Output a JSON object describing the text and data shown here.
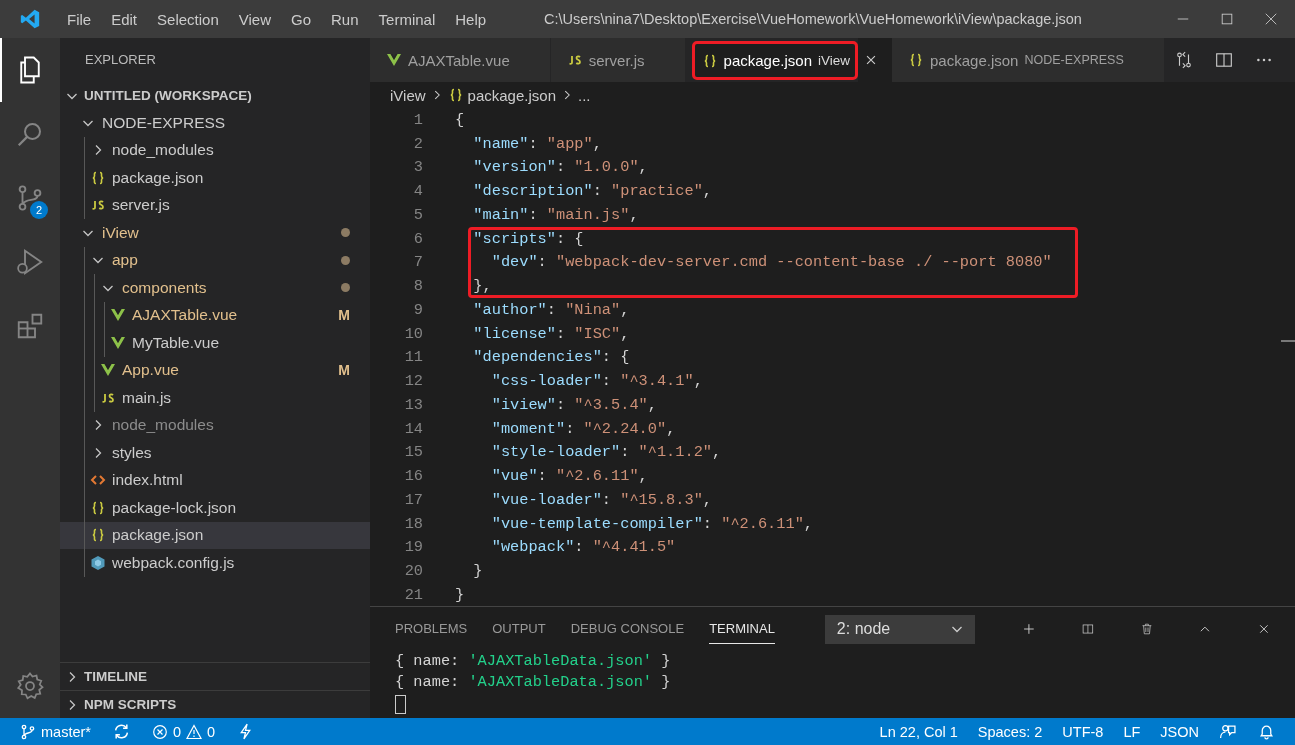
{
  "title_bar": {
    "menus": [
      "File",
      "Edit",
      "Selection",
      "View",
      "Go",
      "Run",
      "Terminal",
      "Help"
    ],
    "title": "C:\\Users\\nina7\\Desktop\\Exercise\\VueHomework\\VueHomework\\iView\\package.json"
  },
  "activity_bar": {
    "source_control_badge": "2"
  },
  "sidebar": {
    "title": "EXPLORER",
    "workspace": {
      "label": "UNTITLED (WORKSPACE)",
      "expanded": true
    },
    "tree": [
      {
        "kind": "folder",
        "label": "NODE-EXPRESS",
        "expanded": true,
        "selected": false,
        "children": [
          {
            "kind": "folder",
            "label": "node_modules",
            "expanded": false,
            "selected": false
          },
          {
            "kind": "json",
            "label": "package.json",
            "selected": false
          },
          {
            "kind": "js",
            "label": "server.js",
            "selected": false
          }
        ]
      },
      {
        "kind": "folder",
        "label": "iView",
        "expanded": true,
        "changed": true,
        "selected": false,
        "children": [
          {
            "kind": "folder",
            "label": "app",
            "expanded": true,
            "changed": true,
            "selected": false,
            "children": [
              {
                "kind": "folder",
                "label": "components",
                "expanded": true,
                "changed": true,
                "selected": false,
                "children": [
                  {
                    "kind": "vue",
                    "label": "AJAXTable.vue",
                    "badge": "M",
                    "selected": false
                  },
                  {
                    "kind": "vue",
                    "label": "MyTable.vue",
                    "selected": false
                  }
                ]
              },
              {
                "kind": "vue",
                "label": "App.vue",
                "badge": "M",
                "selected": false
              },
              {
                "kind": "js",
                "label": "main.js",
                "selected": false
              }
            ]
          },
          {
            "kind": "folder",
            "label": "node_modules",
            "expanded": false,
            "ignored": true,
            "selected": false
          },
          {
            "kind": "folder",
            "label": "styles",
            "expanded": false,
            "selected": false
          },
          {
            "kind": "html",
            "label": "index.html",
            "selected": false
          },
          {
            "kind": "json",
            "label": "package-lock.json",
            "selected": false
          },
          {
            "kind": "json",
            "label": "package.json",
            "selected": true
          },
          {
            "kind": "webpack",
            "label": "webpack.config.js",
            "selected": false
          }
        ]
      }
    ],
    "sections": [
      {
        "label": "TIMELINE",
        "expanded": false
      },
      {
        "label": "NPM SCRIPTS",
        "expanded": false
      }
    ]
  },
  "editor": {
    "tabs": [
      {
        "kind": "vue",
        "label": "AJAXTable.vue",
        "selected": false,
        "highlighted": false
      },
      {
        "kind": "js",
        "label": "server.js",
        "selected": false,
        "highlighted": false
      },
      {
        "kind": "json",
        "label": "package.json",
        "description": "iView",
        "selected": true,
        "highlighted": true
      },
      {
        "kind": "json",
        "label": "package.json",
        "description": "NODE-EXPRESS",
        "selected": false,
        "highlighted": false
      }
    ],
    "breadcrumb": [
      {
        "label": "iView"
      },
      {
        "label": "package.json",
        "kind": "json"
      },
      {
        "label": "..."
      }
    ],
    "lines": [
      {
        "number": "1",
        "highlighted": false,
        "tokens": [
          {
            "kind": "p",
            "text": "{"
          }
        ]
      },
      {
        "number": "2",
        "highlighted": false,
        "tokens": [
          {
            "kind": "k",
            "text": "\"name\""
          },
          {
            "kind": "p",
            "text": ": "
          },
          {
            "kind": "s",
            "text": "\"app\""
          },
          {
            "kind": "p",
            "text": ","
          }
        ]
      },
      {
        "number": "3",
        "highlighted": false,
        "tokens": [
          {
            "kind": "k",
            "text": "\"version\""
          },
          {
            "kind": "p",
            "text": ": "
          },
          {
            "kind": "s",
            "text": "\"1.0.0\""
          },
          {
            "kind": "p",
            "text": ","
          }
        ]
      },
      {
        "number": "4",
        "highlighted": false,
        "tokens": [
          {
            "kind": "k",
            "text": "\"description\""
          },
          {
            "kind": "p",
            "text": ": "
          },
          {
            "kind": "s",
            "text": "\"practice\""
          },
          {
            "kind": "p",
            "text": ","
          }
        ]
      },
      {
        "number": "5",
        "highlighted": false,
        "tokens": [
          {
            "kind": "k",
            "text": "\"main\""
          },
          {
            "kind": "p",
            "text": ": "
          },
          {
            "kind": "s",
            "text": "\"main.js\""
          },
          {
            "kind": "p",
            "text": ","
          }
        ]
      },
      {
        "number": "6",
        "highlighted": true,
        "tokens": [
          {
            "kind": "k",
            "text": "\"scripts\""
          },
          {
            "kind": "p",
            "text": ": {"
          }
        ]
      },
      {
        "number": "7",
        "highlighted": true,
        "tokens": [
          {
            "kind": "k",
            "text": "\"dev\""
          },
          {
            "kind": "p",
            "text": ": "
          },
          {
            "kind": "s",
            "text": "\"webpack-dev-server.cmd --content-base ./ --port 8080\""
          }
        ]
      },
      {
        "number": "8",
        "highlighted": true,
        "tokens": [
          {
            "kind": "p",
            "text": "},"
          }
        ]
      },
      {
        "number": "9",
        "highlighted": false,
        "tokens": [
          {
            "kind": "k",
            "text": "\"author\""
          },
          {
            "kind": "p",
            "text": ": "
          },
          {
            "kind": "s",
            "text": "\"Nina\""
          },
          {
            "kind": "p",
            "text": ","
          }
        ]
      },
      {
        "number": "10",
        "highlighted": false,
        "tokens": [
          {
            "kind": "k",
            "text": "\"license\""
          },
          {
            "kind": "p",
            "text": ": "
          },
          {
            "kind": "s",
            "text": "\"ISC\""
          },
          {
            "kind": "p",
            "text": ","
          }
        ]
      },
      {
        "number": "11",
        "highlighted": false,
        "tokens": [
          {
            "kind": "k",
            "text": "\"dependencies\""
          },
          {
            "kind": "p",
            "text": ": {"
          }
        ]
      },
      {
        "number": "12",
        "highlighted": false,
        "tokens": [
          {
            "kind": "k",
            "text": "\"css-loader\""
          },
          {
            "kind": "p",
            "text": ": "
          },
          {
            "kind": "s",
            "text": "\"^3.4.1\""
          },
          {
            "kind": "p",
            "text": ","
          }
        ]
      },
      {
        "number": "13",
        "highlighted": false,
        "tokens": [
          {
            "kind": "k",
            "text": "\"iview\""
          },
          {
            "kind": "p",
            "text": ": "
          },
          {
            "kind": "s",
            "text": "\"^3.5.4\""
          },
          {
            "kind": "p",
            "text": ","
          }
        ]
      },
      {
        "number": "14",
        "highlighted": false,
        "tokens": [
          {
            "kind": "k",
            "text": "\"moment\""
          },
          {
            "kind": "p",
            "text": ": "
          },
          {
            "kind": "s",
            "text": "\"^2.24.0\""
          },
          {
            "kind": "p",
            "text": ","
          }
        ]
      },
      {
        "number": "15",
        "highlighted": false,
        "tokens": [
          {
            "kind": "k",
            "text": "\"style-loader\""
          },
          {
            "kind": "p",
            "text": ": "
          },
          {
            "kind": "s",
            "text": "\"^1.1.2\""
          },
          {
            "kind": "p",
            "text": ","
          }
        ]
      },
      {
        "number": "16",
        "highlighted": false,
        "tokens": [
          {
            "kind": "k",
            "text": "\"vue\""
          },
          {
            "kind": "p",
            "text": ": "
          },
          {
            "kind": "s",
            "text": "\"^2.6.11\""
          },
          {
            "kind": "p",
            "text": ","
          }
        ]
      },
      {
        "number": "17",
        "highlighted": false,
        "tokens": [
          {
            "kind": "k",
            "text": "\"vue-loader\""
          },
          {
            "kind": "p",
            "text": ": "
          },
          {
            "kind": "s",
            "text": "\"^15.8.3\""
          },
          {
            "kind": "p",
            "text": ","
          }
        ]
      },
      {
        "number": "18",
        "highlighted": false,
        "tokens": [
          {
            "kind": "k",
            "text": "\"vue-template-compiler\""
          },
          {
            "kind": "p",
            "text": ": "
          },
          {
            "kind": "s",
            "text": "\"^2.6.11\""
          },
          {
            "kind": "p",
            "text": ","
          }
        ]
      },
      {
        "number": "19",
        "highlighted": false,
        "tokens": [
          {
            "kind": "k",
            "text": "\"webpack\""
          },
          {
            "kind": "p",
            "text": ": "
          },
          {
            "kind": "s",
            "text": "\"^4.41.5\""
          }
        ]
      },
      {
        "number": "20",
        "highlighted": false,
        "tokens": [
          {
            "kind": "p",
            "text": "}"
          }
        ]
      },
      {
        "number": "21",
        "highlighted": false,
        "tokens": [
          {
            "kind": "p",
            "text": "}"
          }
        ]
      }
    ]
  },
  "panel": {
    "tabs": [
      {
        "label": "PROBLEMS",
        "selected": false
      },
      {
        "label": "OUTPUT",
        "selected": false
      },
      {
        "label": "DEBUG CONSOLE",
        "selected": false
      },
      {
        "label": "TERMINAL",
        "selected": true
      }
    ],
    "terminal_select": "2: node",
    "terminal_lines": [
      [
        {
          "kind": "p",
          "text": "{ name: "
        },
        {
          "kind": "t",
          "text": "'AJAXTableData.json'"
        },
        {
          "kind": "p",
          "text": " }"
        }
      ],
      [
        {
          "kind": "p",
          "text": "{ name: "
        },
        {
          "kind": "t",
          "text": "'AJAXTableData.json'"
        },
        {
          "kind": "p",
          "text": " }"
        }
      ]
    ]
  },
  "status_bar": {
    "branch": "master*",
    "errors": "0",
    "warnings": "0",
    "right": [
      "Ln 22, Col 1",
      "Spaces: 2",
      "UTF-8",
      "LF",
      "JSON"
    ]
  }
}
